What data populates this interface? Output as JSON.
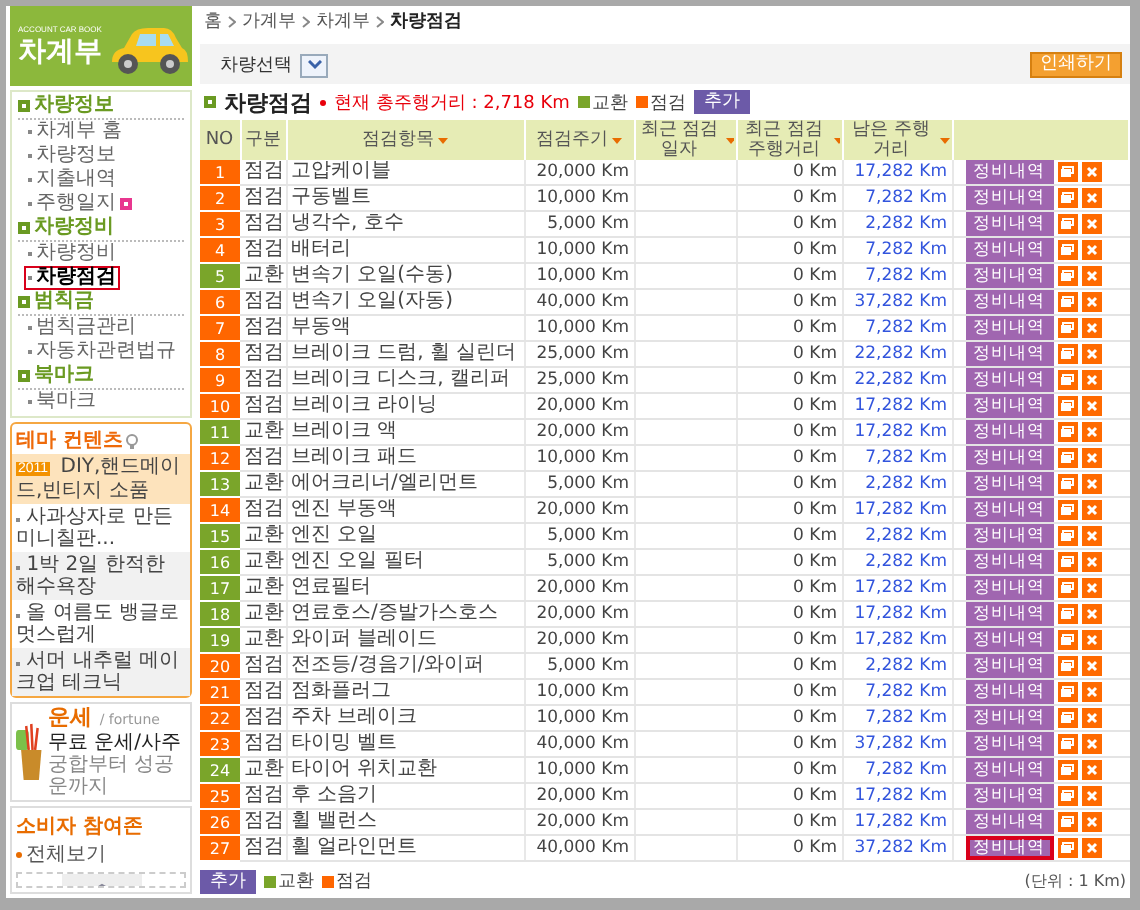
{
  "logo": {
    "subtitle": "ACCOUNT CAR BOOK",
    "title": "차계부"
  },
  "sidebar": {
    "sections": [
      {
        "title": "차량정보",
        "items": [
          {
            "label": "차계부 홈",
            "selected": false,
            "highlighted": false,
            "new": false
          },
          {
            "label": "차량정보",
            "selected": false,
            "highlighted": false,
            "new": false
          },
          {
            "label": "지출내역",
            "selected": false,
            "highlighted": false,
            "new": false
          },
          {
            "label": "주행일지",
            "selected": false,
            "highlighted": false,
            "new": true
          }
        ]
      },
      {
        "title": "차량정비",
        "items": [
          {
            "label": "차량정비",
            "selected": false,
            "highlighted": false,
            "new": false
          },
          {
            "label": "차량점검",
            "selected": true,
            "highlighted": true,
            "new": false
          }
        ]
      },
      {
        "title": "범칙금",
        "items": [
          {
            "label": "범칙금관리",
            "selected": false,
            "highlighted": false,
            "new": false
          },
          {
            "label": "자동차관련법규",
            "selected": false,
            "highlighted": false,
            "new": false
          }
        ]
      },
      {
        "title": "북마크",
        "items": [
          {
            "label": "북마크",
            "selected": false,
            "highlighted": false,
            "new": false
          }
        ]
      }
    ]
  },
  "theme": {
    "title": "테마 컨텐츠",
    "items": [
      {
        "text": "DIY,핸드메이드,빈티지 소품",
        "badge": "2011",
        "featured": true
      },
      {
        "text": "사과상자로 만든 미니칠판...",
        "featured": false
      },
      {
        "text": "1박 2일 한적한 해수욕장",
        "featured": false
      },
      {
        "text": "올 여름도 뱅글로 멋스럽게",
        "featured": false
      },
      {
        "text": "서머 내추럴 메이크업 테크닉",
        "featured": false
      }
    ]
  },
  "fortune": {
    "title": "운세",
    "subtitle": "/ fortune",
    "line1": "무료 운세/사주",
    "line2": "궁합부터 성공운까지"
  },
  "consumer": {
    "title": "소비자 참여존",
    "link": "전체보기"
  },
  "breadcrumb": [
    "홈",
    "가계부",
    "차계부",
    "차량점검"
  ],
  "vehicle_select": {
    "label": "차량선택"
  },
  "print_button": "인쇄하기",
  "section": {
    "title": "차량점검",
    "total": "현재 총주행거리 : 2,718 Km",
    "legend": [
      {
        "label": "교환",
        "color": "#7aa52a"
      },
      {
        "label": "점검",
        "color": "#ff6600"
      }
    ],
    "add_button": "추가"
  },
  "table": {
    "columns": [
      {
        "label": "NO",
        "sortable": false
      },
      {
        "label": "구분",
        "sortable": false
      },
      {
        "label": "점검항목",
        "sortable": true
      },
      {
        "label": "점검주기",
        "sortable": true
      },
      {
        "label": "최근 점검 일자",
        "sortable": true
      },
      {
        "label": "최근 점검 주행거리",
        "sortable": true
      },
      {
        "label": "남은 주행거리",
        "sortable": true
      }
    ],
    "rows": [
      {
        "no": "1",
        "kind": "inspect",
        "type": "점검",
        "item": "고압케이블",
        "cycle": "20,000 Km",
        "last": "0 Km",
        "remaining": "17,282 Km",
        "button": "정비내역",
        "highlighted": false
      },
      {
        "no": "2",
        "kind": "inspect",
        "type": "점검",
        "item": "구동벨트",
        "cycle": "10,000 Km",
        "last": "0 Km",
        "remaining": "7,282 Km",
        "button": "정비내역",
        "highlighted": false
      },
      {
        "no": "3",
        "kind": "inspect",
        "type": "점검",
        "item": "냉각수, 호수",
        "cycle": "5,000 Km",
        "last": "0 Km",
        "remaining": "2,282 Km",
        "button": "정비내역",
        "highlighted": false
      },
      {
        "no": "4",
        "kind": "inspect",
        "type": "점검",
        "item": "배터리",
        "cycle": "10,000 Km",
        "last": "0 Km",
        "remaining": "7,282 Km",
        "button": "정비내역",
        "highlighted": false
      },
      {
        "no": "5",
        "kind": "replace",
        "type": "교환",
        "item": "변속기 오일(수동)",
        "cycle": "10,000 Km",
        "last": "0 Km",
        "remaining": "7,282 Km",
        "button": "정비내역",
        "highlighted": false
      },
      {
        "no": "6",
        "kind": "inspect",
        "type": "점검",
        "item": "변속기 오일(자동)",
        "cycle": "40,000 Km",
        "last": "0 Km",
        "remaining": "37,282 Km",
        "button": "정비내역",
        "highlighted": false
      },
      {
        "no": "7",
        "kind": "inspect",
        "type": "점검",
        "item": "부동액",
        "cycle": "10,000 Km",
        "last": "0 Km",
        "remaining": "7,282 Km",
        "button": "정비내역",
        "highlighted": false
      },
      {
        "no": "8",
        "kind": "inspect",
        "type": "점검",
        "item": "브레이크 드럼, 휠 실린더",
        "cycle": "25,000 Km",
        "last": "0 Km",
        "remaining": "22,282 Km",
        "button": "정비내역",
        "highlighted": false
      },
      {
        "no": "9",
        "kind": "inspect",
        "type": "점검",
        "item": "브레이크 디스크, 캘리퍼",
        "cycle": "25,000 Km",
        "last": "0 Km",
        "remaining": "22,282 Km",
        "button": "정비내역",
        "highlighted": false
      },
      {
        "no": "10",
        "kind": "inspect",
        "type": "점검",
        "item": "브레이크 라이닝",
        "cycle": "20,000 Km",
        "last": "0 Km",
        "remaining": "17,282 Km",
        "button": "정비내역",
        "highlighted": false
      },
      {
        "no": "11",
        "kind": "replace",
        "type": "교환",
        "item": "브레이크 액",
        "cycle": "20,000 Km",
        "last": "0 Km",
        "remaining": "17,282 Km",
        "button": "정비내역",
        "highlighted": false
      },
      {
        "no": "12",
        "kind": "inspect",
        "type": "점검",
        "item": "브레이크 패드",
        "cycle": "10,000 Km",
        "last": "0 Km",
        "remaining": "7,282 Km",
        "button": "정비내역",
        "highlighted": false
      },
      {
        "no": "13",
        "kind": "replace",
        "type": "교환",
        "item": "에어크리너/엘리먼트",
        "cycle": "5,000 Km",
        "last": "0 Km",
        "remaining": "2,282 Km",
        "button": "정비내역",
        "highlighted": false
      },
      {
        "no": "14",
        "kind": "inspect",
        "type": "점검",
        "item": "엔진 부동액",
        "cycle": "20,000 Km",
        "last": "0 Km",
        "remaining": "17,282 Km",
        "button": "정비내역",
        "highlighted": false
      },
      {
        "no": "15",
        "kind": "replace",
        "type": "교환",
        "item": "엔진 오일",
        "cycle": "5,000 Km",
        "last": "0 Km",
        "remaining": "2,282 Km",
        "button": "정비내역",
        "highlighted": false
      },
      {
        "no": "16",
        "kind": "replace",
        "type": "교환",
        "item": "엔진 오일 필터",
        "cycle": "5,000 Km",
        "last": "0 Km",
        "remaining": "2,282 Km",
        "button": "정비내역",
        "highlighted": false
      },
      {
        "no": "17",
        "kind": "replace",
        "type": "교환",
        "item": "연료필터",
        "cycle": "20,000 Km",
        "last": "0 Km",
        "remaining": "17,282 Km",
        "button": "정비내역",
        "highlighted": false
      },
      {
        "no": "18",
        "kind": "replace",
        "type": "교환",
        "item": "연료호스/증발가스호스",
        "cycle": "20,000 Km",
        "last": "0 Km",
        "remaining": "17,282 Km",
        "button": "정비내역",
        "highlighted": false
      },
      {
        "no": "19",
        "kind": "replace",
        "type": "교환",
        "item": "와이퍼 블레이드",
        "cycle": "20,000 Km",
        "last": "0 Km",
        "remaining": "17,282 Km",
        "button": "정비내역",
        "highlighted": false
      },
      {
        "no": "20",
        "kind": "inspect",
        "type": "점검",
        "item": "전조등/경음기/와이퍼",
        "cycle": "5,000 Km",
        "last": "0 Km",
        "remaining": "2,282 Km",
        "button": "정비내역",
        "highlighted": false
      },
      {
        "no": "21",
        "kind": "inspect",
        "type": "점검",
        "item": "점화플러그",
        "cycle": "10,000 Km",
        "last": "0 Km",
        "remaining": "7,282 Km",
        "button": "정비내역",
        "highlighted": false
      },
      {
        "no": "22",
        "kind": "inspect",
        "type": "점검",
        "item": "주차 브레이크",
        "cycle": "10,000 Km",
        "last": "0 Km",
        "remaining": "7,282 Km",
        "button": "정비내역",
        "highlighted": false
      },
      {
        "no": "23",
        "kind": "inspect",
        "type": "점검",
        "item": "타이밍 벨트",
        "cycle": "40,000 Km",
        "last": "0 Km",
        "remaining": "37,282 Km",
        "button": "정비내역",
        "highlighted": false
      },
      {
        "no": "24",
        "kind": "replace",
        "type": "교환",
        "item": "타이어 위치교환",
        "cycle": "10,000 Km",
        "last": "0 Km",
        "remaining": "7,282 Km",
        "button": "정비내역",
        "highlighted": false
      },
      {
        "no": "25",
        "kind": "inspect",
        "type": "점검",
        "item": "후 소음기",
        "cycle": "20,000 Km",
        "last": "0 Km",
        "remaining": "17,282 Km",
        "button": "정비내역",
        "highlighted": false
      },
      {
        "no": "26",
        "kind": "inspect",
        "type": "점검",
        "item": "휠 밸런스",
        "cycle": "20,000 Km",
        "last": "0 Km",
        "remaining": "17,282 Km",
        "button": "정비내역",
        "highlighted": false
      },
      {
        "no": "27",
        "kind": "inspect",
        "type": "점검",
        "item": "휠 얼라인먼트",
        "cycle": "40,000 Km",
        "last": "0 Km",
        "remaining": "37,282 Km",
        "button": "정비내역",
        "highlighted": true
      }
    ]
  },
  "footer": {
    "add_button": "추가",
    "legend": [
      {
        "label": "교환",
        "color": "#7aa52a"
      },
      {
        "label": "점검",
        "color": "#ff6600"
      }
    ],
    "unit": "(단위 : 1 Km)"
  }
}
